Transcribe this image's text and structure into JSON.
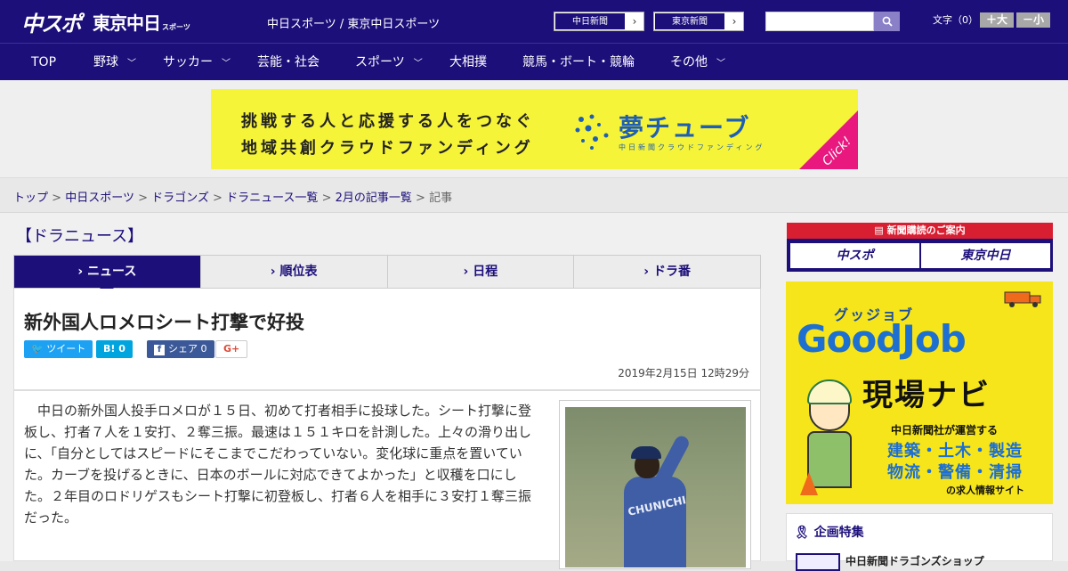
{
  "header": {
    "logo_main": "中スポ",
    "logo_tokyo": "東京中日",
    "logo_sports": "スポーツ",
    "site_name": "中日スポーツ / 東京中日スポーツ",
    "paper_links": [
      {
        "label": "中日新聞"
      },
      {
        "label": "東京新聞"
      }
    ],
    "search": {
      "placeholder": "",
      "value": ""
    },
    "font_size": {
      "label": "文字（0）",
      "bigger": "＋大",
      "smaller": "－小"
    }
  },
  "nav": {
    "items": [
      {
        "label": "TOP",
        "has_menu": false
      },
      {
        "label": "野球",
        "has_menu": true
      },
      {
        "label": "サッカー",
        "has_menu": true
      },
      {
        "label": "芸能・社会",
        "has_menu": false
      },
      {
        "label": "スポーツ",
        "has_menu": true
      },
      {
        "label": "大相撲",
        "has_menu": false
      },
      {
        "label": "競馬・ボート・競輪",
        "has_menu": false
      },
      {
        "label": "その他",
        "has_menu": true
      }
    ]
  },
  "banner": {
    "line1": "挑戦する人と応援する人をつなぐ",
    "line2": "地域共創クラウドファンディング",
    "logo": "夢チューブ",
    "sub": "中日新聞クラウドファンディング",
    "click": "Click!",
    "colors": {
      "bg": "#f6f438",
      "accent": "#e8187f",
      "logo": "#1f5fb3"
    }
  },
  "breadcrumb": {
    "items": [
      {
        "label": "トップ",
        "link": true
      },
      {
        "label": "中日スポーツ",
        "link": true
      },
      {
        "label": "ドラゴンズ",
        "link": true
      },
      {
        "label": "ドラニュース一覧",
        "link": true
      },
      {
        "label": "2月の記事一覧",
        "link": true
      },
      {
        "label": "記事",
        "link": false
      }
    ],
    "separator": ">"
  },
  "section_title": "【ドラニュース】",
  "tabs": [
    {
      "label": "ニュース",
      "active": true
    },
    {
      "label": "順位表",
      "active": false
    },
    {
      "label": "日程",
      "active": false
    },
    {
      "label": "ドラ番",
      "active": false
    }
  ],
  "article": {
    "title": "新外国人ロメロシート打撃で好投",
    "share": {
      "tweet": "ツイート",
      "hatena": "B! 0",
      "facebook": "シェア 0",
      "gplus": "G+"
    },
    "date": "2019年2月15日 12時29分",
    "body": "中日の新外国人投手ロメロが１５日、初めて打者相手に投球した。シート打撃に登板し、打者７人を１安打、２奪三振。最速は１５１キロを計測した。上々の滑り出しに、「自分としてはスピードにそこまでこだわっていない。変化球に重点を置いていた。カーブを投げるときに、日本のボールに対応できてよかった」と収穫を口にした。２年目のロドリゲスもシート打撃に初登板し、打者６人を相手に３安打１奪三振だった。",
    "photo_jersey": "CHUNICHI"
  },
  "sidebar": {
    "subscribe": {
      "head": "新聞購読のご案内",
      "btn1": "中スポ",
      "btn2": "東京中日"
    },
    "goodjob": {
      "small": "グッジョブ",
      "big": "GoodJob",
      "navi": "現場ナビ",
      "line1": "中日新聞社が運営する",
      "line2": "建築・土木・製造",
      "line3": "物流・警備・清掃",
      "line4": "の求人情報サイト"
    },
    "feature": {
      "title": "企画特集",
      "item": "中日新聞ドラゴンズショップ"
    }
  },
  "colors": {
    "brand": "#1c0f7a",
    "header_bg": "#1c0f7a",
    "twitter": "#1da1f2",
    "hatena": "#00a4de",
    "facebook": "#3b5998",
    "subscribe_red": "#d81e31"
  }
}
